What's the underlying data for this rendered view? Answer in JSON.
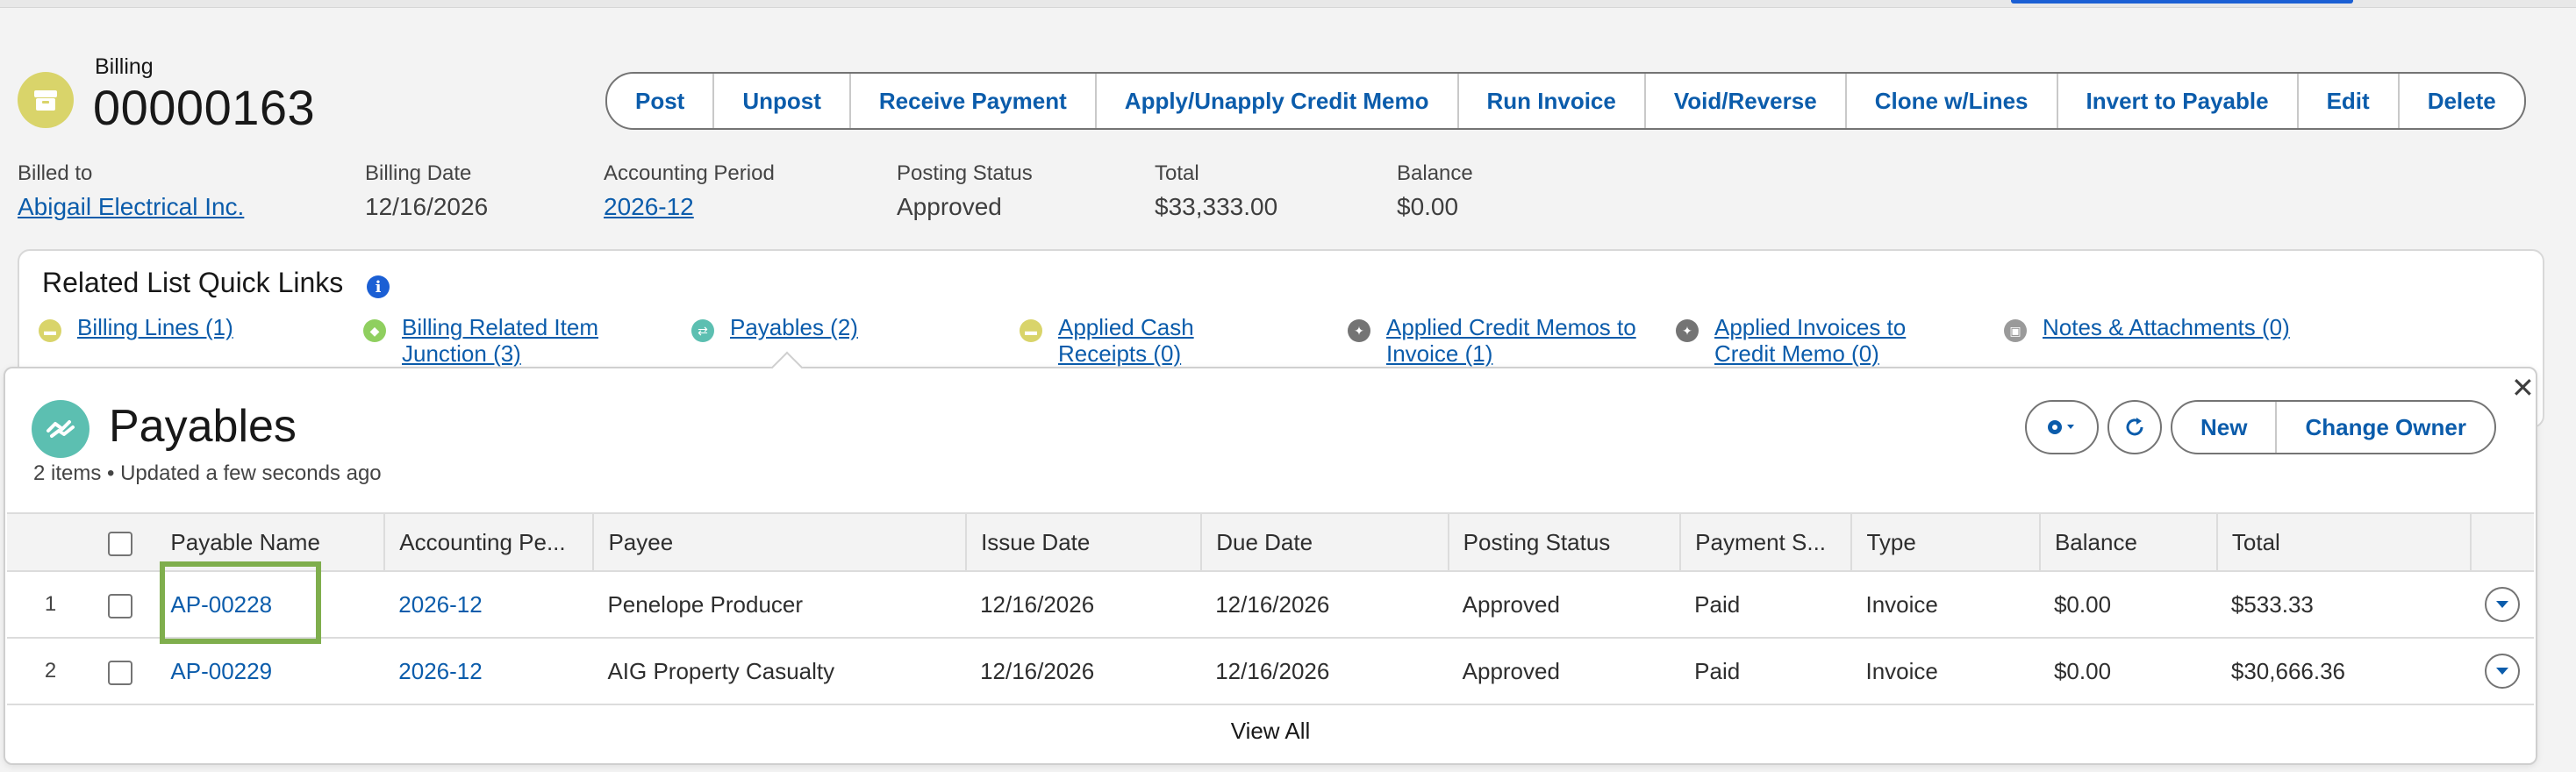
{
  "record": {
    "type_label": "Billing",
    "name": "00000163"
  },
  "actions": [
    "Post",
    "Unpost",
    "Receive Payment",
    "Apply/Unapply Credit Memo",
    "Run Invoice",
    "Void/Reverse",
    "Clone w/Lines",
    "Invert to Payable",
    "Edit",
    "Delete"
  ],
  "fields": {
    "billed_to": {
      "label": "Billed to",
      "value": "Abigail Electrical Inc."
    },
    "billing_date": {
      "label": "Billing Date",
      "value": "12/16/2026"
    },
    "accounting_period": {
      "label": "Accounting Period",
      "value": "2026-12"
    },
    "posting_status": {
      "label": "Posting Status",
      "value": "Approved"
    },
    "total": {
      "label": "Total",
      "value": "$33,333.00"
    },
    "balance": {
      "label": "Balance",
      "value": "$0.00"
    }
  },
  "quick_links": {
    "title": "Related List Quick Links",
    "info_glyph": "i",
    "items": [
      {
        "label": "Billing Lines (1)",
        "icon": "billing-icon",
        "color": "#d9d46a"
      },
      {
        "label": "Billing Related Item Junction (3)",
        "icon": "junction-icon",
        "color": "#8fcf5f"
      },
      {
        "label": "Payables (2)",
        "icon": "payables-icon",
        "color": "#5cbfb1"
      },
      {
        "label": "Applied Cash Receipts (0)",
        "icon": "receipt-icon",
        "color": "#d9d46a"
      },
      {
        "label": "Applied Credit Memos to Invoice (1)",
        "icon": "wrench-icon",
        "color": "#747474"
      },
      {
        "label": "Applied Invoices to Credit Memo (0)",
        "icon": "wrench-icon",
        "color": "#747474"
      },
      {
        "label": "Notes & Attachments (0)",
        "icon": "attachment-icon",
        "color": "#9a9a9a"
      }
    ]
  },
  "payables": {
    "title": "Payables",
    "subtitle": "2 items • Updated a few seconds ago",
    "close_glyph": "✕",
    "buttons": {
      "new": "New",
      "change_owner": "Change Owner"
    },
    "columns": [
      "Payable Name",
      "Accounting Pe...",
      "Payee",
      "Issue Date",
      "Due Date",
      "Posting Status",
      "Payment S...",
      "Type",
      "Balance",
      "Total"
    ],
    "rows": [
      {
        "num": "1",
        "name": "AP-00228",
        "period": "2026-12",
        "payee": "Penelope Producer",
        "issue": "12/16/2026",
        "due": "12/16/2026",
        "posting": "Approved",
        "payment": "Paid",
        "type": "Invoice",
        "balance": "$0.00",
        "total": "$533.33"
      },
      {
        "num": "2",
        "name": "AP-00229",
        "period": "2026-12",
        "payee": "AIG Property Casualty",
        "issue": "12/16/2026",
        "due": "12/16/2026",
        "posting": "Approved",
        "payment": "Paid",
        "type": "Invoice",
        "balance": "$0.00",
        "total": "$30,666.36"
      }
    ],
    "view_all": "View All"
  },
  "colors": {
    "link": "#0b5cab",
    "highlight": "#7fae4d",
    "payables_icon": "#5cbfb1",
    "billing_icon": "#d9d46a"
  }
}
